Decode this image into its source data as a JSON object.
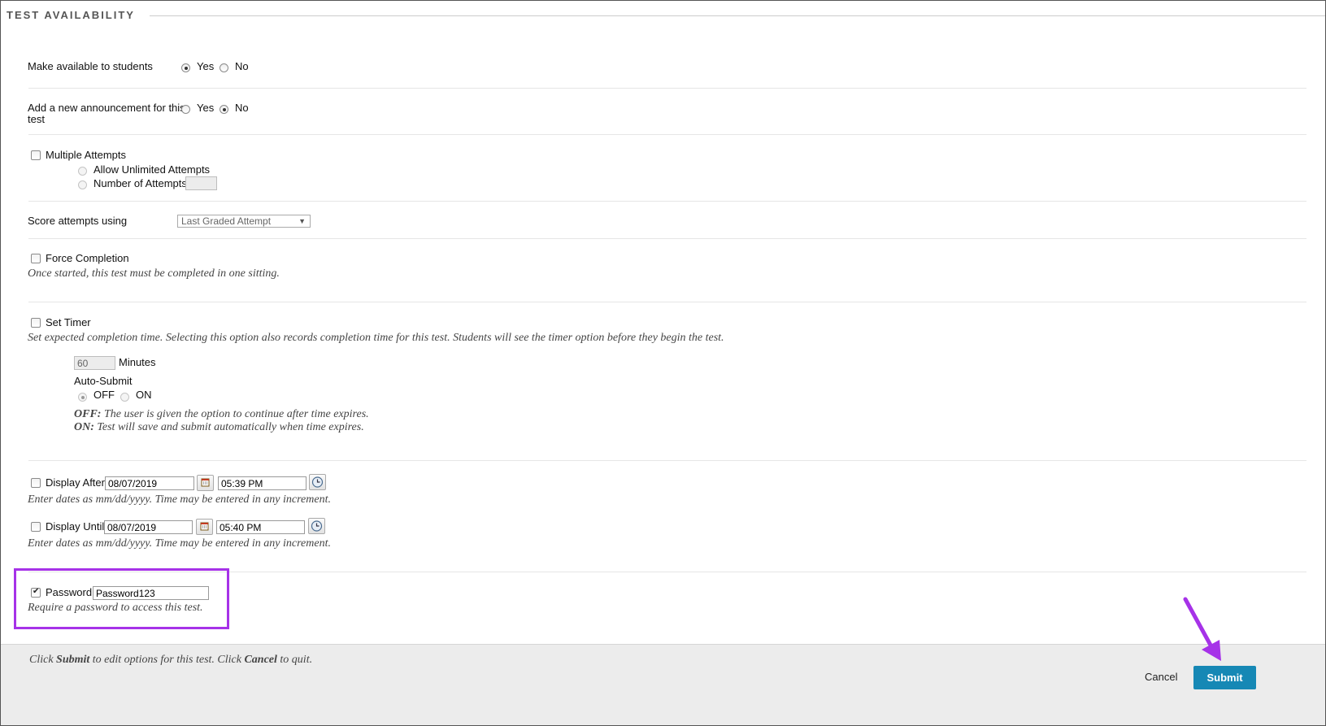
{
  "section": {
    "title": "TEST AVAILABILITY"
  },
  "availability": {
    "label": "Make available to students",
    "yes": "Yes",
    "no": "No",
    "selected": "Yes"
  },
  "announcement": {
    "label_line1": "Add a new announcement for this",
    "label_line2": "test",
    "yes": "Yes",
    "no": "No",
    "selected": "No"
  },
  "attempts": {
    "label": "Multiple Attempts",
    "checked": false,
    "unlimited": "Allow Unlimited Attempts",
    "number": "Number of Attempts",
    "number_value": ""
  },
  "score": {
    "label": "Score attempts using",
    "selected": "Last Graded Attempt"
  },
  "force": {
    "label": "Force Completion",
    "checked": false,
    "help": "Once started, this test must be completed in one sitting."
  },
  "timer": {
    "label": "Set Timer",
    "checked": false,
    "help": "Set expected completion time. Selecting this option also records completion time for this test. Students will see the timer option before they begin the test.",
    "minutes_value": "60",
    "minutes_label": "Minutes",
    "auto_submit_label": "Auto-Submit",
    "off": "OFF",
    "on": "ON",
    "selected": "OFF",
    "off_help_key": "OFF:",
    "off_help": "The user is given the option to continue after time expires.",
    "on_help_key": "ON:",
    "on_help": "Test will save and submit automatically when time expires."
  },
  "display_after": {
    "label": "Display After",
    "checked": false,
    "date": "08/07/2019",
    "time": "05:39 PM",
    "help": "Enter dates as mm/dd/yyyy. Time may be entered in any increment."
  },
  "display_until": {
    "label": "Display Until",
    "checked": false,
    "date": "08/07/2019",
    "time": "05:40 PM",
    "help": "Enter dates as mm/dd/yyyy. Time may be entered in any increment."
  },
  "password": {
    "label": "Password",
    "checked": true,
    "value": "Password123",
    "help": "Require a password to access this test."
  },
  "footer": {
    "instr_1": "Click ",
    "instr_submit": "Submit",
    "instr_2": " to edit options for this test. Click ",
    "instr_cancel": "Cancel",
    "instr_3": " to quit.",
    "cancel": "Cancel",
    "submit": "Submit"
  },
  "colors": {
    "highlight": "#a632e8",
    "submit_bg": "#1688b5"
  }
}
